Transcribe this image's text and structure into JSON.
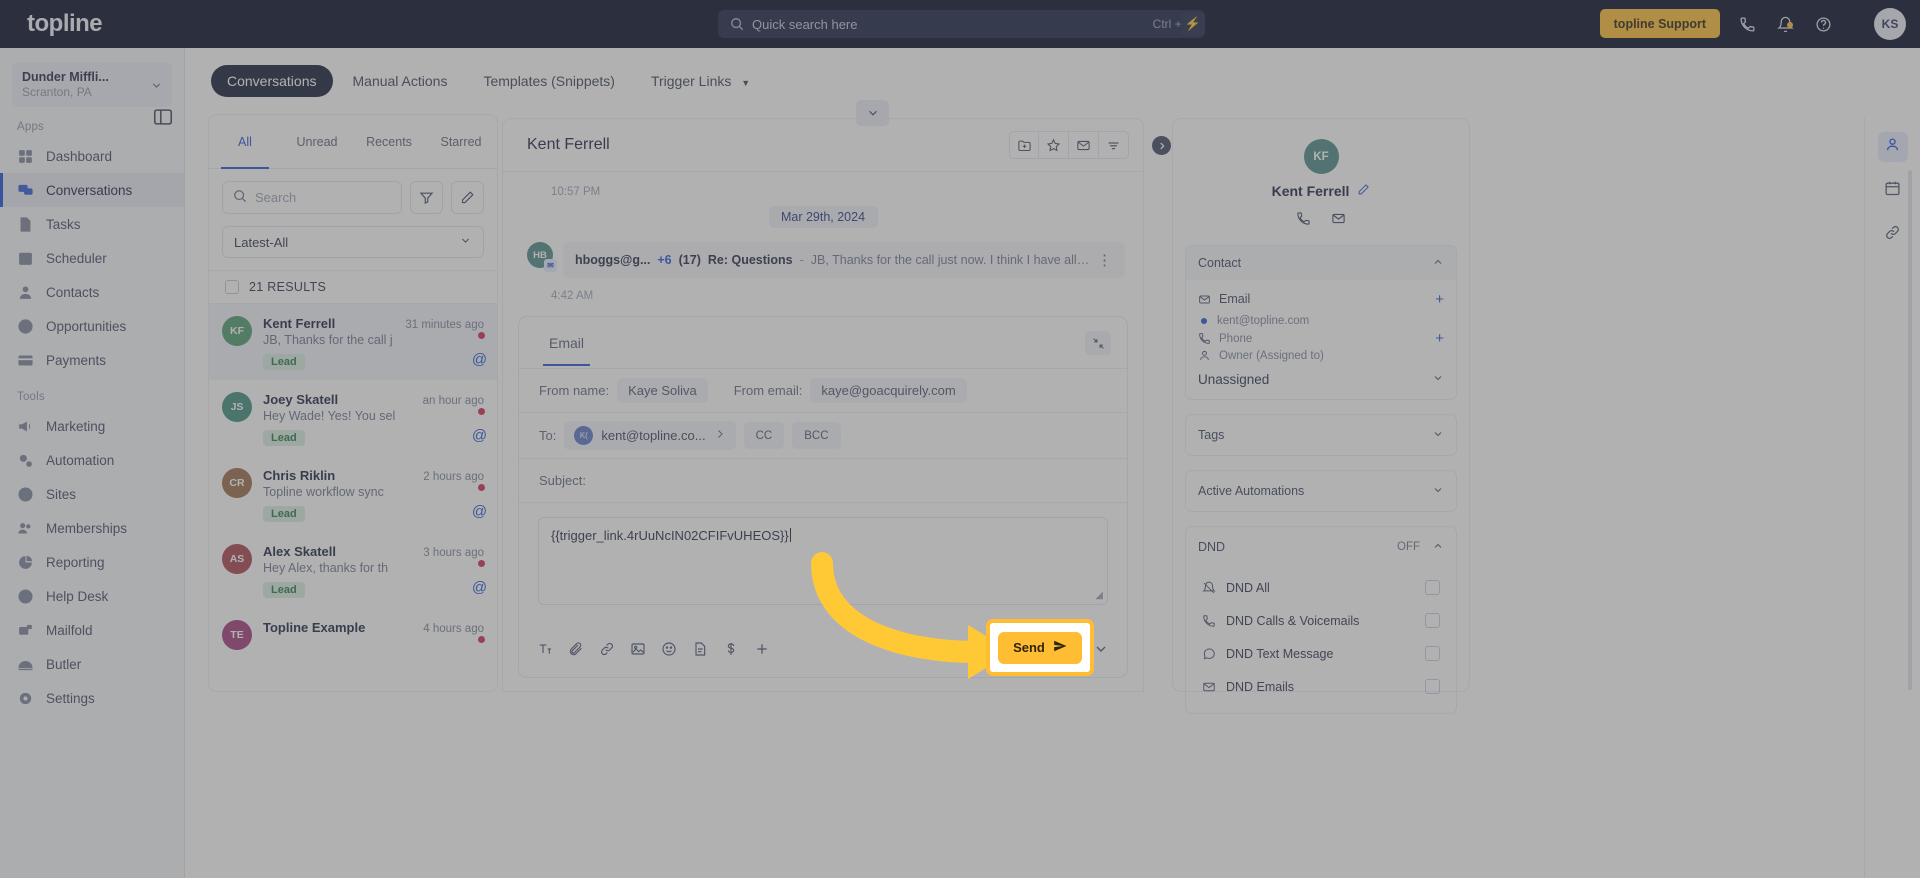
{
  "topbar": {
    "brand": "topline",
    "search_placeholder": "Quick search here",
    "search_shortcut": "Ctrl + K",
    "bolt_icon": "lightning-icon",
    "support_label": "topline Support",
    "phone_icon": "phone-icon",
    "bell_icon": "bell-icon",
    "help_icon": "help-icon",
    "avatar_initials": "KS"
  },
  "sidebar": {
    "location_name": "Dunder Miffli...",
    "location_sub": "Scranton, PA",
    "groups": [
      {
        "label": "Apps",
        "items": [
          {
            "label": "Dashboard",
            "icon": "dashboard-icon",
            "active": false
          },
          {
            "label": "Conversations",
            "icon": "conversations-icon",
            "active": true
          },
          {
            "label": "Tasks",
            "icon": "tasks-icon",
            "active": false
          },
          {
            "label": "Scheduler",
            "icon": "calendar-icon",
            "active": false
          },
          {
            "label": "Contacts",
            "icon": "contacts-icon",
            "active": false
          },
          {
            "label": "Opportunities",
            "icon": "opportunities-icon",
            "active": false
          },
          {
            "label": "Payments",
            "icon": "payments-icon",
            "active": false
          }
        ]
      },
      {
        "label": "Tools",
        "items": [
          {
            "label": "Marketing",
            "icon": "megaphone-icon",
            "active": false
          },
          {
            "label": "Automation",
            "icon": "gears-icon",
            "active": false
          },
          {
            "label": "Sites",
            "icon": "globe-icon",
            "active": false
          },
          {
            "label": "Memberships",
            "icon": "members-icon",
            "active": false
          },
          {
            "label": "Reporting",
            "icon": "pie-chart-icon",
            "active": false
          },
          {
            "label": "Help Desk",
            "icon": "question-circle-icon",
            "active": false
          },
          {
            "label": "Mailfold",
            "icon": "mailfold-icon",
            "active": false
          },
          {
            "label": "Butler",
            "icon": "butler-icon",
            "active": false
          },
          {
            "label": "Settings",
            "icon": "gear-icon",
            "active": false
          }
        ]
      }
    ]
  },
  "tabsbar": {
    "tabs": [
      {
        "label": "Conversations",
        "active": true,
        "caret": false
      },
      {
        "label": "Manual Actions",
        "active": false,
        "caret": false
      },
      {
        "label": "Templates (Snippets)",
        "active": false,
        "caret": false
      },
      {
        "label": "Trigger Links",
        "active": false,
        "caret": true
      }
    ]
  },
  "conversation_list": {
    "tabs": [
      {
        "label": "All",
        "active": true
      },
      {
        "label": "Unread",
        "active": false
      },
      {
        "label": "Recents",
        "active": false
      },
      {
        "label": "Starred",
        "active": false
      }
    ],
    "search_placeholder": "Search",
    "filter_icon": "filter-icon",
    "compose_icon": "pencil-icon",
    "sort_value": "Latest-All",
    "results_label": "21 RESULTS",
    "items": [
      {
        "initials": "KF",
        "avatar_color": "#4e9c6c",
        "name": "Kent Ferrell",
        "time": "31 minutes ago",
        "snippet": "JB, Thanks for the call j",
        "tag": "Lead",
        "selected": true,
        "unread": true,
        "channel_icon": "at-icon"
      },
      {
        "initials": "JS",
        "avatar_color": "#3f8d7c",
        "name": "Joey Skatell",
        "time": "an hour ago",
        "snippet": "Hey Wade! Yes! You sel",
        "tag": "Lead",
        "selected": false,
        "unread": true,
        "channel_icon": "at-icon"
      },
      {
        "initials": "CR",
        "avatar_color": "#9a6b48",
        "name": "Chris Riklin",
        "time": "2 hours ago",
        "snippet": "Topline workflow sync",
        "tag": "Lead",
        "selected": false,
        "unread": true,
        "channel_icon": "at-icon"
      },
      {
        "initials": "AS",
        "avatar_color": "#a8434c",
        "name": "Alex Skatell",
        "time": "3 hours ago",
        "snippet": "Hey Alex, thanks for th",
        "tag": "Lead",
        "selected": false,
        "unread": true,
        "channel_icon": "at-icon"
      },
      {
        "initials": "TE",
        "avatar_color": "#a33a78",
        "name": "Topline Example",
        "time": "4 hours ago",
        "snippet": "",
        "tag": "",
        "selected": false,
        "unread": false,
        "channel_icon": "at-icon"
      }
    ]
  },
  "thread": {
    "title": "Kent Ferrell",
    "tools": [
      {
        "icon": "folder-plus-icon",
        "name": "add-to-folder-button"
      },
      {
        "icon": "star-icon",
        "name": "star-button"
      },
      {
        "icon": "envelope-icon",
        "name": "mark-unread-button"
      },
      {
        "icon": "filter-lines-icon",
        "name": "filter-button"
      }
    ],
    "collapse_icon": "chevron-down-icon",
    "time_top": "10:57 PM",
    "date_pill": "Mar 29th, 2024",
    "message": {
      "avatar_initials": "HB",
      "badge_icon": "email-badge-icon",
      "from": "hboggs@g...",
      "plus_count": "+6",
      "thread_count": "(17)",
      "subject": "Re: Questions",
      "dash": "-",
      "preview": "JB, Thanks for the call just now.  I think I have all of the business informatio...",
      "kebab_icon": "more-vertical-icon"
    },
    "time_bottom": "4:42 AM"
  },
  "composer": {
    "tab_label": "Email",
    "expand_icon": "collapse-diagonal-icon",
    "from_name_label": "From name:",
    "from_name_value": "Kaye Soliva",
    "from_email_label": "From email:",
    "from_email_value": "kaye@goacquirely.com",
    "to_label": "To:",
    "to_initials": "K(",
    "to_value": "kent@topline.co...",
    "to_chevron": "chevron-right-icon",
    "cc_label": "CC",
    "bcc_label": "BCC",
    "subject_label": "Subject:",
    "body_text": "{{trigger_link.4rUuNcIN02CFIFvUHEOS}}",
    "toolbar_icons": [
      "text-format-icon",
      "attachment-icon",
      "link-icon",
      "image-icon",
      "emoji-icon",
      "template-icon",
      "payment-icon",
      "plus-icon"
    ],
    "send_label": "Send",
    "send_icon": "paper-plane-icon",
    "send_caret_icon": "chevron-down-icon"
  },
  "right_panel": {
    "avatar_initials": "KF",
    "name": "Kent Ferrell",
    "edit_icon": "pencil-icon",
    "action_icons": [
      "phone-icon",
      "envelope-icon"
    ],
    "contact": {
      "title": "Contact",
      "chevron": "chevron-up-icon",
      "email_label": "Email",
      "email_value": "kent@topline.com",
      "phone_label": "Phone",
      "owner_label": "Owner (Assigned to)",
      "owner_value": "Unassigned",
      "add_icon": "plus-icon"
    },
    "tags": {
      "title": "Tags",
      "chevron": "chevron-down-icon"
    },
    "automations": {
      "title": "Active Automations",
      "chevron": "chevron-down-icon"
    },
    "dnd": {
      "title": "DND",
      "state": "OFF",
      "chevron": "chevron-up-icon",
      "rows": [
        {
          "label": "DND All",
          "icon": "dnd-all-icon",
          "checked": false
        },
        {
          "label": "DND Calls & Voicemails",
          "icon": "phone-icon",
          "checked": false
        },
        {
          "label": "DND Text Message",
          "icon": "message-icon",
          "checked": false
        },
        {
          "label": "DND Emails",
          "icon": "envelope-icon",
          "checked": false
        }
      ]
    }
  },
  "rail": {
    "buttons": [
      {
        "icon": "person-icon",
        "active": true
      },
      {
        "icon": "calendar-icon",
        "active": false
      },
      {
        "icon": "link-icon",
        "active": false
      }
    ],
    "expand_icon": "chevron-right-icon"
  },
  "annotation": {
    "arrow_color": "#ffc936",
    "highlight_color": "#ffbd33",
    "target_label": "Send"
  }
}
